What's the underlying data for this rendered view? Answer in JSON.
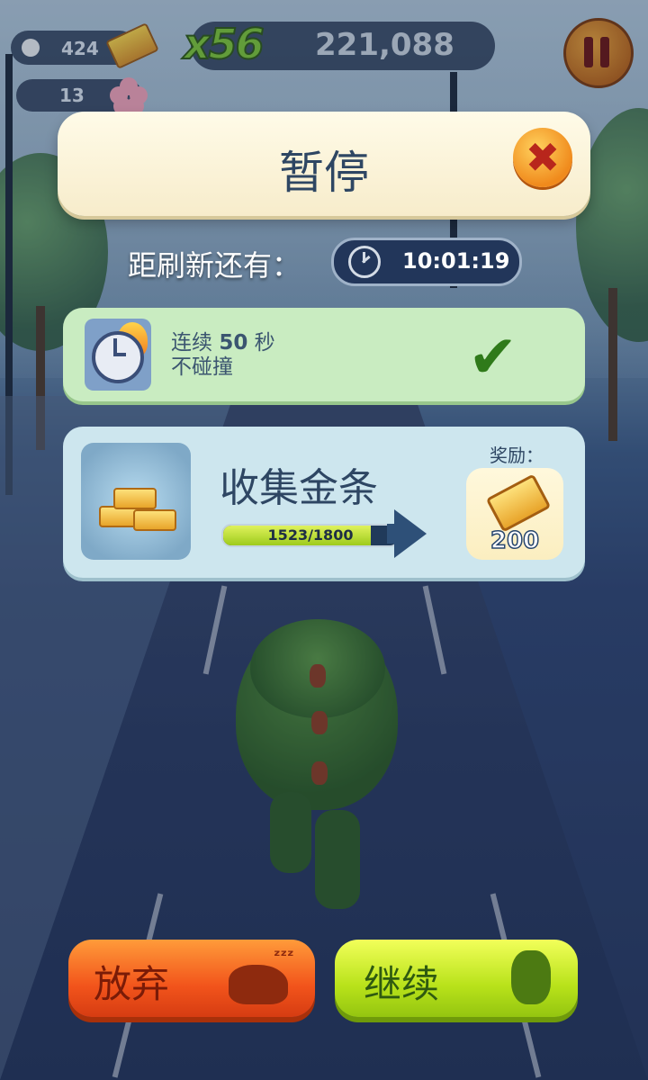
{
  "hud": {
    "coins": "424",
    "flowers": "13",
    "multiplier": "x56",
    "score": "221,088"
  },
  "pause_dialog": {
    "title": "暂停",
    "refresh_label": "距刷新还有：",
    "refresh_timer": "10:01:19",
    "task_streak": {
      "line1_prefix": "连续 ",
      "line1_number": "50",
      "line1_suffix": " 秒",
      "line2": "不碰撞",
      "completed": true
    },
    "task_collect": {
      "title": "收集金条",
      "progress_text": "1523/1800",
      "progress_fraction": 0.846,
      "reward_label": "奖励：",
      "reward_value": "200"
    }
  },
  "buttons": {
    "give_up": "放弃",
    "continue": "继续"
  },
  "colors": {
    "give_up_button": "#f2541b",
    "continue_button": "#b8e21a",
    "task_done_bg": "#c9ecc1",
    "task_active_bg": "#cde6ee",
    "title_text": "#2e4663"
  },
  "icons": {
    "coin": "coin-icon",
    "gold_bar": "gold-bar-icon",
    "flower": "flower-icon",
    "pause": "pause-icon",
    "close": "close-icon",
    "clock": "clock-icon",
    "flaming_clock": "flaming-clock-icon",
    "checkmark": "checkmark-icon",
    "arrow": "arrow-right-icon",
    "sleeping_cat": "sleeping-cat-icon",
    "running_cat": "running-cat-icon"
  }
}
